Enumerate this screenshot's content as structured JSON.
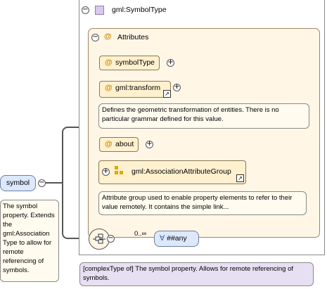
{
  "complex_type": {
    "title": "gml:SymbolType",
    "collapse_glyph": "−",
    "icon": "complex-type-icon",
    "note": "[complexType of] The symbol property. Allows for remote referencing of symbols."
  },
  "attributes": {
    "label": "Attributes",
    "at_glyph": "@",
    "items": [
      {
        "name": "symbolType",
        "expand_glyph": "+"
      },
      {
        "name": "gml:transform",
        "expand_glyph": "+",
        "doc": "Defines the geometric transformation of entities. There is no particular grammar defined for this value."
      },
      {
        "name": "about",
        "expand_glyph": "+"
      }
    ],
    "group": {
      "name": "gml:AssociationAttributeGroup",
      "expand_glyph": "+",
      "doc": "Attribute group used to enable property elements to refer to their value remotely. It contains the simple link..."
    }
  },
  "element": {
    "name": "symbol",
    "collapse_glyph": "−",
    "doc": "The symbol property. Extends the gml:Association Type to allow for remote referencing of symbols."
  },
  "sequence": {
    "collapse_glyph": "−",
    "occurs": "0..∞",
    "any_label": "##any",
    "any_glyph": "∀"
  },
  "shortcut_glyph": "↗",
  "colors": {
    "element_fill": "#dce8fb",
    "type_note_fill": "#e6e0f2",
    "attribute_fill": "#fff1cf",
    "attributes_panel": "#fff6e6",
    "at_sign": "#d08a00"
  }
}
